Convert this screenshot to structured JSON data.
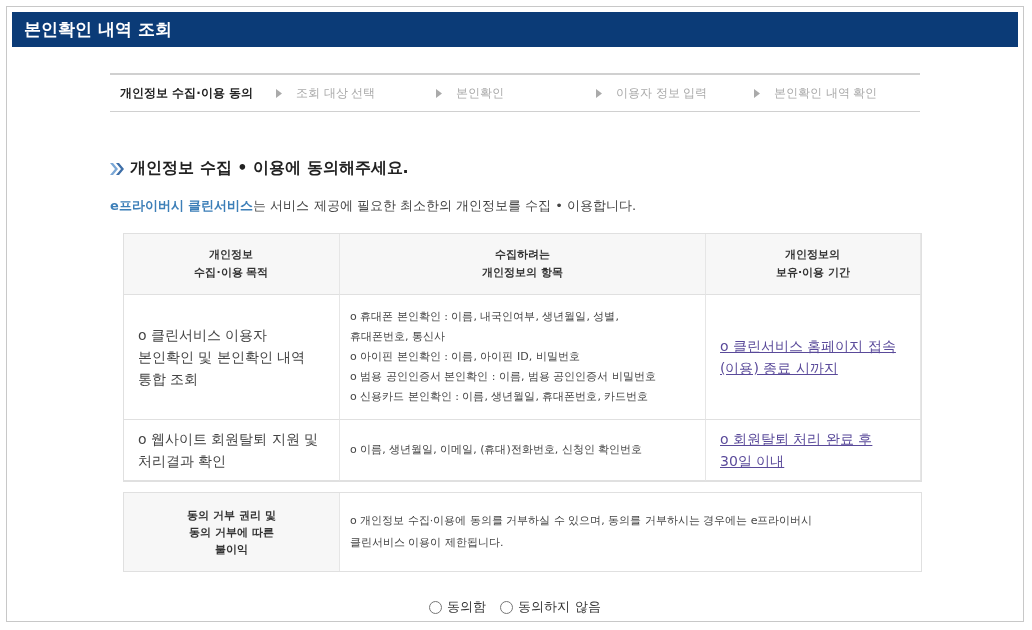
{
  "header": {
    "title": "본인확인 내역 조회"
  },
  "steps": [
    {
      "label": "개인정보 수집·이용 동의",
      "selected": true
    },
    {
      "label": "조회 대상 선택",
      "selected": false
    },
    {
      "label": "본인확인",
      "selected": false
    },
    {
      "label": "이용자 정보 입력",
      "selected": false
    },
    {
      "label": "본인확인 내역 확인",
      "selected": false
    }
  ],
  "heading": "개인정보 수집 • 이용에 동의해주세요.",
  "intro": "**e프라이버시 클린서비스**는 서비스 제공에 필요한 최소한의 개인정보를 수집 • 이용합니다.",
  "table": {
    "columns": [
      "개인정보\n수집·이용 목적",
      "수집하려는\n개인정보의 항목",
      "개인정보의\n보유·이용 기간"
    ],
    "rows": [
      {
        "purpose": "o 클린서비스 이용자\n본인확인 및 본인확인 내역\n통합 조회",
        "items": [
          "o 휴대폰 본인확인 : 이름, 내국인여부, 생년월일, 성별,\n휴대폰번호, 통신사",
          "o 아이핀 본인확인 : 이름, 아이핀 ID, 비밀번호",
          "o 범용 공인인증서 본인확인 : 이름, 범용 공인인증서 비밀번호",
          "o 신용카드 본인확인 : 이름, 생년월일, 휴대폰번호, 카드번호"
        ],
        "period": "o 클린서비스 홈페이지 접속\n(이용) 종료 시까지"
      },
      {
        "purpose": "o 웹사이트 회원탈퇴 지원 및\n처리결과 확인",
        "items": [
          "o 이름, 생년월일, 이메일, (휴대)전화번호, 신청인 확인번호"
        ],
        "period": "o 회원탈퇴 처리 완료 후\n30일 이내"
      }
    ]
  },
  "refusal": {
    "label": "동의 거부 권리 및\n동의 거부에 따른\n불이익",
    "text": "o 개인정보 수집·이용에 동의를 거부하실 수 있으며, 동의를 거부하시는 경우에는 e프라이버시\n클린서비스 이용이 제한됩니다."
  },
  "consent": [
    {
      "label": "동의함",
      "selected": false
    },
    {
      "label": "동의하지 않음",
      "selected": false
    }
  ]
}
